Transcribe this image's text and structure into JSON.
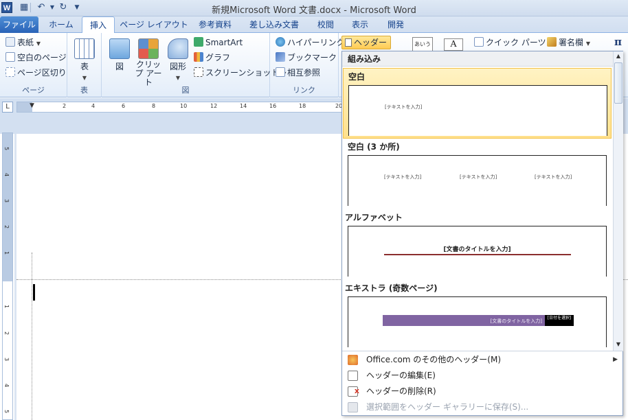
{
  "window": {
    "title": "新規Microsoft Word 文書.docx - Microsoft Word",
    "app_icon_letter": "W"
  },
  "quick_access": {
    "save_icon": "save-icon",
    "undo_icon": "undo-icon",
    "redo_icon": "redo-icon"
  },
  "tabs": [
    {
      "label": "ファイル"
    },
    {
      "label": "ホーム"
    },
    {
      "label": "挿入"
    },
    {
      "label": "ページ レイアウト"
    },
    {
      "label": "参考資料"
    },
    {
      "label": "差し込み文書"
    },
    {
      "label": "校閲"
    },
    {
      "label": "表示"
    },
    {
      "label": "開発"
    }
  ],
  "ribbon": {
    "pages_group": {
      "label": "ページ",
      "cover": "表紙",
      "blank": "空白のページ",
      "break": "ページ区切り"
    },
    "table_group": {
      "label": "表",
      "table": "表"
    },
    "illustrations_group": {
      "label": "図",
      "picture": "図",
      "clipart": "クリップ アート",
      "shapes": "図形",
      "smartart": "SmartArt",
      "chart": "グラフ",
      "screenshot": "スクリーンショット"
    },
    "links_group": {
      "label": "リンク",
      "hyperlink": "ハイパーリンク",
      "bookmark": "ブックマーク",
      "crossref": "相互参照"
    },
    "header_button": "ヘッダー",
    "quick_parts": "クイック パーツ",
    "signature": "署名欄",
    "equation_symbol": "π"
  },
  "ruler": {
    "h_numbers": [
      "2",
      "2",
      "4",
      "6",
      "8",
      "10",
      "12",
      "14",
      "16",
      "18",
      "20"
    ],
    "v_numbers": [
      "5",
      "4",
      "3",
      "2",
      "1",
      "1",
      "2",
      "3",
      "4",
      "5"
    ]
  },
  "gallery": {
    "section_title": "組み込み",
    "items": [
      {
        "name": "空白",
        "placeholders": [
          "[テキストを入力]"
        ]
      },
      {
        "name": "空白 (3 か所)",
        "placeholders": [
          "[テキストを入力]",
          "[テキストを入力]",
          "[テキストを入力]"
        ]
      },
      {
        "name": "アルファベット",
        "title_placeholder": "[文書のタイトルを入力]"
      },
      {
        "name": "エキストラ (奇数ページ)",
        "title_placeholder": "[文書のタイトルを入力]",
        "date_placeholder": "[日付を選択]"
      }
    ],
    "menu": [
      {
        "label": "Office.com のその他のヘッダー(M)",
        "icon": "office-online-icon",
        "disabled": false
      },
      {
        "label": "ヘッダーの編集(E)",
        "icon": "edit-header-icon",
        "disabled": false
      },
      {
        "label": "ヘッダーの削除(R)",
        "icon": "delete-header-icon",
        "disabled": false
      },
      {
        "label": "選択範囲をヘッダー ギャラリーに保存(S)...",
        "icon": "save-selection-icon",
        "disabled": true
      }
    ]
  },
  "colors": {
    "accent": "#2b579a",
    "selection": "#ffe08c",
    "alphabet_rule": "#8b2e2e",
    "extra_bar": "#8064a2"
  }
}
